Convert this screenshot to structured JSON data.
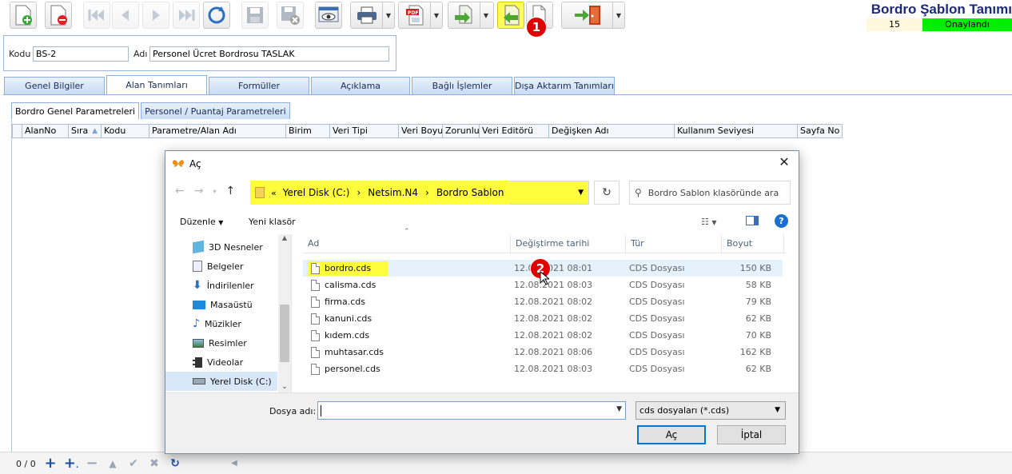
{
  "app": {
    "title": "Bordro Şablon Tanımı",
    "record_no": "15",
    "status": "Onaylandı",
    "status_color": "#00ee00"
  },
  "toolbar": {
    "buttons": [
      "new-document-icon",
      "delete-document-icon",
      "first-record-icon",
      "previous-record-icon",
      "next-record-icon",
      "last-record-icon",
      "refresh-icon",
      "save-icon",
      "cancel-save-icon",
      "preview-icon",
      "print-icon",
      "pdf-icon",
      "export-icon",
      "import-icon",
      "copy-icon",
      "exit-icon"
    ],
    "marker_1": "1",
    "marker_2": "2"
  },
  "header": {
    "kodu_label": "Kodu",
    "kodu_value": "BS-2",
    "adi_label": "Adı",
    "adi_value": "Personel  Ücret Bordrosu TASLAK"
  },
  "tabs": [
    "Genel Bilgiler",
    "Alan Tanımları",
    "Formüller",
    "Açıklama",
    "Bağlı İşlemler",
    "Dışa Aktarım Tanımları"
  ],
  "subtabs": [
    "Bordro Genel Parametreleri",
    "Personel / Puantaj Parametreleri"
  ],
  "grid": {
    "columns": [
      "AlanNo",
      "Sıra",
      "Kodu",
      "Parametre/Alan Adı",
      "Birim",
      "Veri Tipi",
      "Veri Boyu",
      "Zorunlu",
      "Veri Editörü",
      "Değişken Adı",
      "Kullanım Seviyesi",
      "Sayfa No"
    ]
  },
  "navigator": {
    "count": "0 / 0"
  },
  "dialog": {
    "title": "Aç",
    "close": "✕",
    "path_prefix": "«",
    "path": [
      "Yerel Disk (C:)",
      "Netsim.N4",
      "Bordro Sablon"
    ],
    "path_sep": "›",
    "search_placeholder": "Bordro Sablon klasöründe ara",
    "organize": "Düzenle",
    "new_folder": "Yeni klasör",
    "sidebar": [
      "3D Nesneler",
      "Belgeler",
      "İndirilenler",
      "Masaüstü",
      "Müzikler",
      "Resimler",
      "Videolar",
      "Yerel Disk (C:)"
    ],
    "columns": [
      "Ad",
      "Değiştirme tarihi",
      "Tür",
      "Boyut"
    ],
    "files": [
      {
        "name": "bordro.cds",
        "date": "12.08.2021 08:01",
        "type": "CDS Dosyası",
        "size": "150 KB"
      },
      {
        "name": "calisma.cds",
        "date": "12.08.2021 08:03",
        "type": "CDS Dosyası",
        "size": "58 KB"
      },
      {
        "name": "firma.cds",
        "date": "12.08.2021 08:02",
        "type": "CDS Dosyası",
        "size": "79 KB"
      },
      {
        "name": "kanuni.cds",
        "date": "12.08.2021 08:02",
        "type": "CDS Dosyası",
        "size": "62 KB"
      },
      {
        "name": "kıdem.cds",
        "date": "12.08.2021 08:02",
        "type": "CDS Dosyası",
        "size": "70 KB"
      },
      {
        "name": "muhtasar.cds",
        "date": "12.08.2021 08:06",
        "type": "CDS Dosyası",
        "size": "162 KB"
      },
      {
        "name": "personel.cds",
        "date": "12.08.2021 08:03",
        "type": "CDS Dosyası",
        "size": "62 KB"
      }
    ],
    "filename_label": "Dosya adı:",
    "filename_value": "",
    "filter": "cds dosyaları (*.cds)",
    "open_button": "Aç",
    "cancel_button": "İptal"
  },
  "colors": {
    "highlight": "#fffc3b",
    "badge": "#e00000",
    "title_blue": "#1b2a78"
  }
}
